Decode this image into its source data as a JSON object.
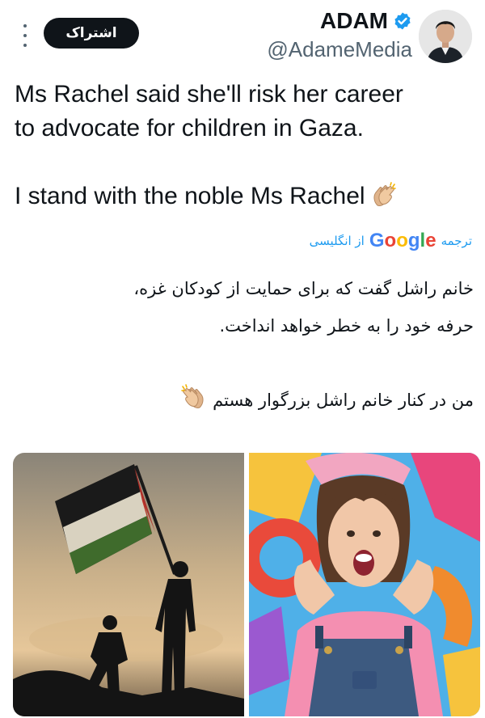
{
  "author": {
    "display_name": "ADAM",
    "handle": "@AdameMedia",
    "verified_icon": "verified-badge-icon",
    "follow_label": "اشتراک"
  },
  "tweet": {
    "line_1": "Ms Rachel said she'll risk her career",
    "line_2": "to advocate for children in Gaza.",
    "line_3": "I stand with the noble Ms Rachel"
  },
  "translation": {
    "prefix": "ترجمه",
    "brand": [
      "G",
      "o",
      "o",
      "g",
      "l",
      "e"
    ],
    "brand_colors": [
      "#4285F4",
      "#EA4335",
      "#FBBC05",
      "#4285F4",
      "#34A853",
      "#EA4335"
    ],
    "suffix": "از انگلیسی",
    "line_1": "خانم راشل گفت که برای حمایت از کودکان غزه،",
    "line_2": "حرفه خود را به خطر خواهد انداخت.",
    "line_3": "من در کنار خانم راشل بزرگوار هستم"
  },
  "colors": {
    "accent": "#1d9bf0",
    "verified": "#1d9bf0",
    "text": "#0f1419",
    "muted": "#536471"
  }
}
